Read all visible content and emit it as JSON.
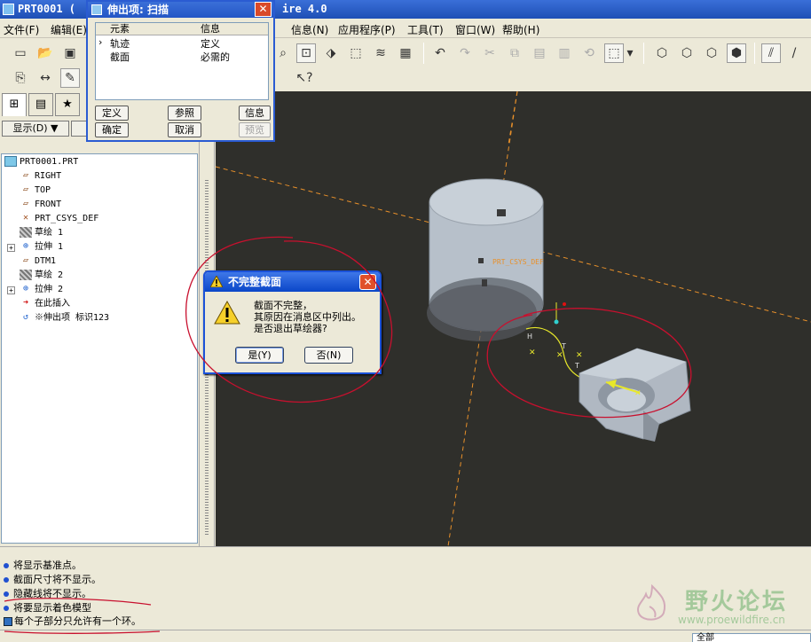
{
  "window": {
    "title_left": "PRT0001 (",
    "title_right": "ire 4.0"
  },
  "menu": [
    {
      "label": "文件(F)"
    },
    {
      "label": "编辑(E)"
    },
    {
      "label": "信息(N)"
    },
    {
      "label": "应用程序(P)"
    },
    {
      "label": "工具(T)"
    },
    {
      "label": "窗口(W)"
    },
    {
      "label": "帮助(H)"
    }
  ],
  "nav": {
    "show_label": "显示(D) ▼"
  },
  "tree": {
    "items": [
      {
        "label": "PRT0001.PRT",
        "icon": "part-icon"
      },
      {
        "label": "RIGHT",
        "icon": "datum-plane-icon"
      },
      {
        "label": "TOP",
        "icon": "datum-plane-icon"
      },
      {
        "label": "FRONT",
        "icon": "datum-plane-icon"
      },
      {
        "label": "PRT_CSYS_DEF",
        "icon": "csys-icon"
      },
      {
        "label": "草绘 1",
        "icon": "sketch-icon"
      },
      {
        "label": "拉伸 1",
        "icon": "extrude-icon"
      },
      {
        "label": "DTM1",
        "icon": "datum-plane-icon"
      },
      {
        "label": "草绘 2",
        "icon": "sketch-icon"
      },
      {
        "label": "拉伸 2",
        "icon": "extrude-icon"
      },
      {
        "label": "在此插入",
        "icon": "insert-arrow-icon"
      },
      {
        "label": "※伸出项 标识123",
        "icon": "sweep-icon"
      }
    ]
  },
  "extrude_dialog": {
    "title": "伸出项: 扫描",
    "col_element": "元素",
    "col_info": "信息",
    "rows": [
      {
        "element": "轨迹",
        "info": "定义"
      },
      {
        "element": "截面",
        "info": "必需的"
      }
    ],
    "btn_define": "定义",
    "btn_ref": "参照",
    "btn_info": "信息",
    "btn_ok": "确定",
    "btn_cancel": "取消",
    "btn_preview": "预览"
  },
  "warning_dialog": {
    "title": "不完整截面",
    "line1": "截面不完整，",
    "line2": "其原因在消息区中列出。",
    "line3": "是否退出草绘器?",
    "btn_yes": "是(Y)",
    "btn_no": "否(N)"
  },
  "viewport": {
    "csys_label": "PRT_CSYS_DEF",
    "label_h": "H",
    "label_t1": "T",
    "label_t2": "T"
  },
  "messages": [
    "将显示基准点。",
    "截面尺寸将不显示。",
    "隐藏线将不显示。",
    "将要显示着色模型",
    "每个子部分只允许有一个环。"
  ],
  "status": {
    "filter": "全部"
  },
  "watermark": {
    "text": "野火论坛",
    "url": "www.proewildfire.cn"
  },
  "colors": {
    "viewport_bg": "#2f2f2b",
    "annotation_red": "#c8102e",
    "sketch_yellow": "#e8e82a",
    "axis_orange": "#e8902a",
    "title_blue": "#2456c6"
  }
}
